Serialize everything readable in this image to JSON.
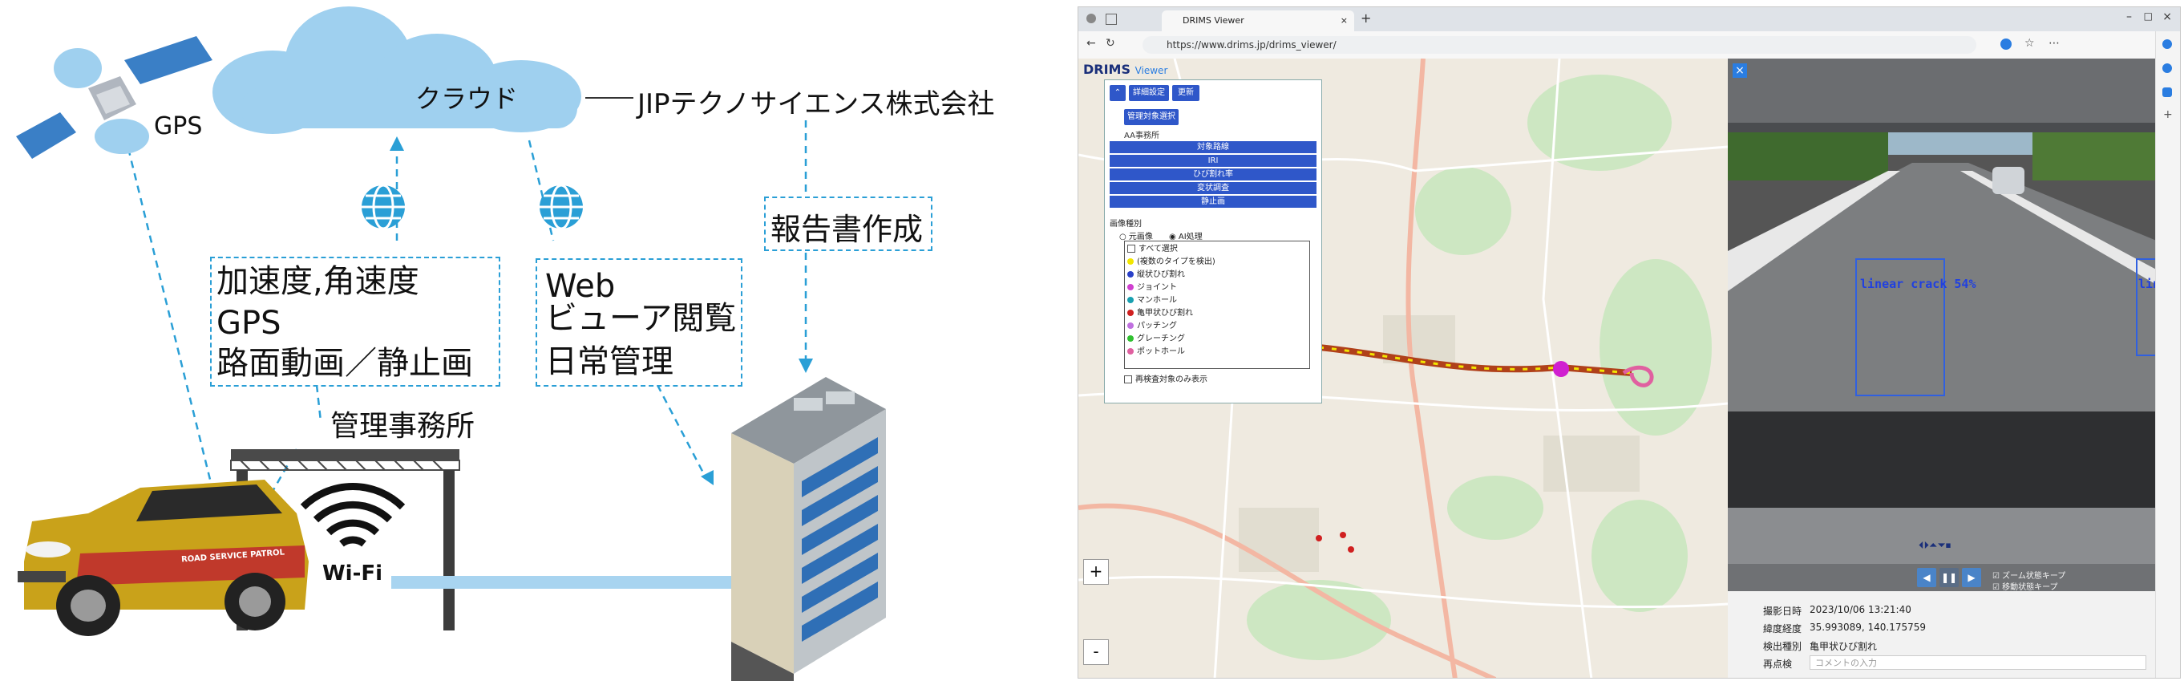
{
  "diagram": {
    "gps_label": "GPS",
    "cloud_label": "クラウド",
    "company_label": "JIPテクノサイエンス株式会社",
    "report_label": "報告書作成",
    "upload_box": {
      "lines": [
        "加速度,角速度",
        "GPS",
        "路面動画／静止画"
      ]
    },
    "web_box": {
      "lines": [
        "Web",
        "ビューア閲覧",
        "日常管理"
      ]
    },
    "office_label": "管理事務所",
    "wifi_label": "Wi-Fi",
    "car_decal": "ROAD SERVICE PATROL",
    "colors": {
      "cloud": "#9fd0ef",
      "dash": "#2a9fd6",
      "pipe": "#a8d4f0"
    }
  },
  "browser": {
    "tab_title": "DRIMS Viewer",
    "url": "https://www.drims.jp/drims_viewer/"
  },
  "viewer": {
    "logo": "DRIMS",
    "logo_sub": "Viewer",
    "top_buttons": [
      "詳細設定",
      "更新"
    ],
    "office_select_button": "管理対象選択",
    "office_name": "AA事務所",
    "category_rows": [
      "対象路線",
      "IRI",
      "ひび割れ率",
      "変状調査",
      "静止画"
    ],
    "image_type_label": "画像種別",
    "image_type_options": [
      "元画像",
      "AI処理"
    ],
    "damage_options": [
      {
        "label": "すべて選択",
        "color": ""
      },
      {
        "label": "(複数のタイプを検出)",
        "color": "#f2e600"
      },
      {
        "label": "縦状ひび割れ",
        "color": "#2a40c8"
      },
      {
        "label": "ジョイント",
        "color": "#d040d0"
      },
      {
        "label": "マンホール",
        "color": "#18a0b0"
      },
      {
        "label": "亀甲状ひび割れ",
        "color": "#d02020"
      },
      {
        "label": "パッチング",
        "color": "#c070e0"
      },
      {
        "label": "グレーチング",
        "color": "#30c030"
      },
      {
        "label": "ポットホール",
        "color": "#e060a0"
      }
    ],
    "footer_option": "再検査対象のみ表示",
    "zoom_in": "+",
    "zoom_out": "-",
    "detection_labels": [
      "linear crack 54%",
      "lin"
    ],
    "playback_checks": [
      "ズーム状態キープ",
      "移動状態キープ"
    ],
    "info": [
      {
        "label": "撮影日時",
        "value": "2023/10/06 13:21:40"
      },
      {
        "label": "緯度経度",
        "value": "35.993089, 140.175759"
      },
      {
        "label": "検出種別",
        "value": "亀甲状ひび割れ"
      },
      {
        "label": "再点検",
        "value": "コメントの入力"
      }
    ]
  }
}
